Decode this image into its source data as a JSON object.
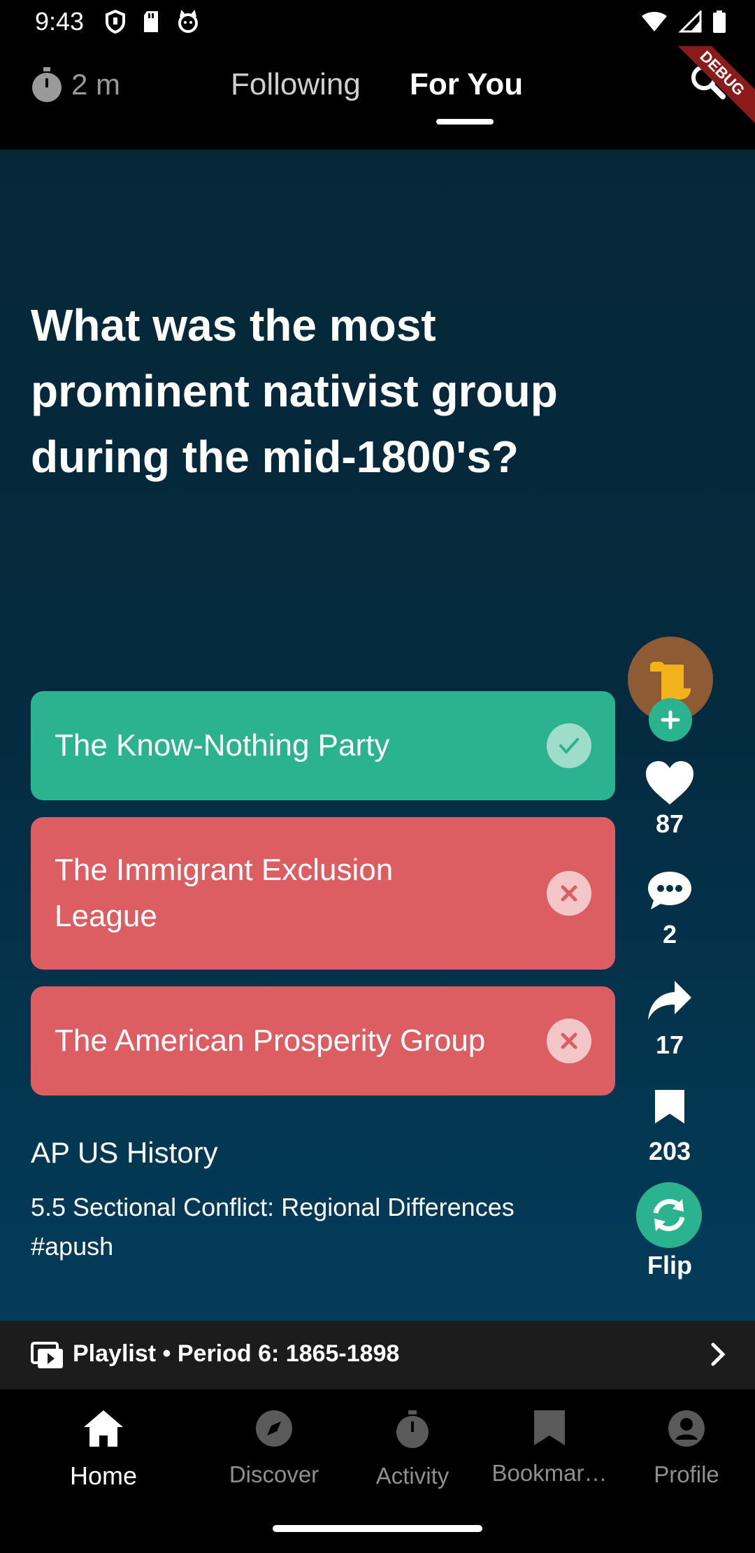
{
  "status_bar": {
    "time": "9:43"
  },
  "header": {
    "timer": "2 m",
    "tabs": [
      {
        "label": "Following",
        "active": false
      },
      {
        "label": "For You",
        "active": true
      }
    ],
    "debug_ribbon": "DEBUG"
  },
  "card": {
    "question": "What was the most prominent nativist group during the mid-1800's?",
    "answers": [
      {
        "label": "The Know-Nothing Party",
        "state": "correct"
      },
      {
        "label": "The Immigrant Exclusion League",
        "state": "wrong"
      },
      {
        "label": "The American Prosperity Group",
        "state": "wrong"
      }
    ],
    "subject": "AP US History",
    "description": "5.5 Sectional Conflict: Regional Differences #apush"
  },
  "actions": {
    "likes": "87",
    "comments": "2",
    "shares": "17",
    "bookmarks": "203",
    "flip_label": "Flip"
  },
  "playlist": {
    "label": "Playlist • Period 6: 1865-1898"
  },
  "bottom_nav": [
    {
      "label": "Home",
      "icon": "home-icon",
      "active": true
    },
    {
      "label": "Discover",
      "icon": "compass-icon",
      "active": false
    },
    {
      "label": "Activity",
      "icon": "stopwatch-icon",
      "active": false
    },
    {
      "label": "Bookmar…",
      "icon": "bookmark-icon",
      "active": false
    },
    {
      "label": "Profile",
      "icon": "profile-icon",
      "active": false
    }
  ],
  "colors": {
    "correct": "#2bb28e",
    "wrong": "#dc5e62",
    "background_top": "#062836",
    "background_bottom": "#033c5a"
  }
}
